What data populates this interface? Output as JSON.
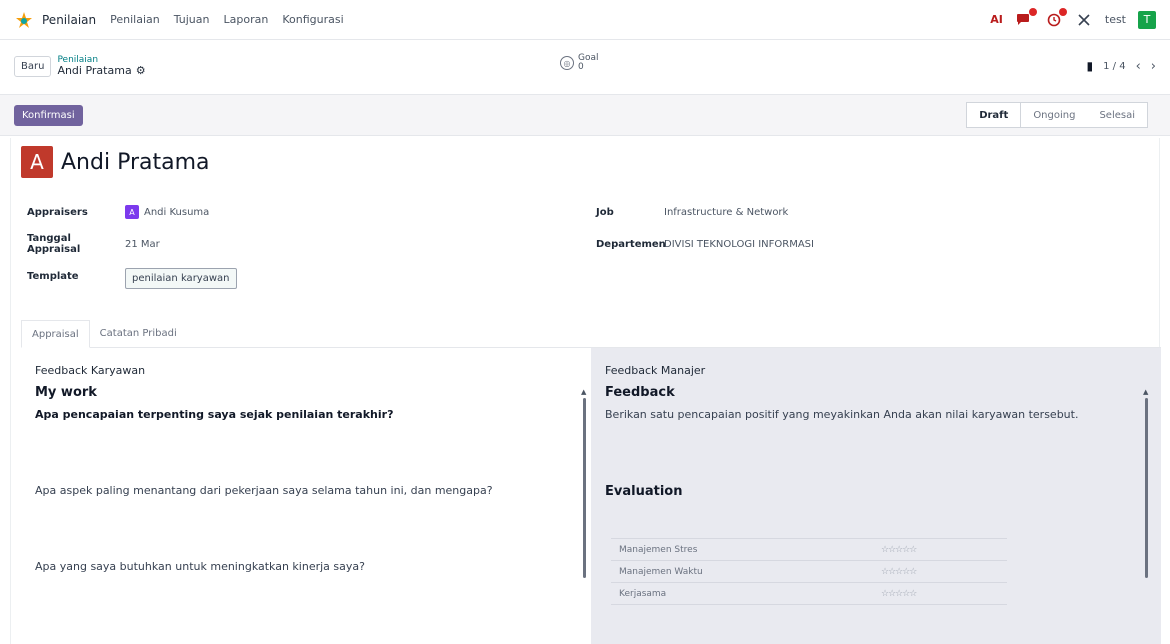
{
  "navbar": {
    "brand": "Penilaian",
    "menu": [
      "Penilaian",
      "Tujuan",
      "Laporan",
      "Konfigurasi"
    ],
    "ai_label": "AI",
    "company": "test",
    "avatar_letter": "T"
  },
  "control": {
    "new_label": "Baru",
    "breadcrumb_parent": "Penilaian",
    "breadcrumb_current": "Andi Pratama",
    "goal_label": "Goal",
    "goal_count": "0",
    "pager": "1 / 4"
  },
  "actions": {
    "confirm_label": "Konfirmasi",
    "stages": [
      "Draft",
      "Ongoing",
      "Selesai"
    ],
    "active_stage": "Draft"
  },
  "record": {
    "avatar_letter": "A",
    "name": "Andi Pratama",
    "fields_left": {
      "appraisers_label": "Appraisers",
      "appraiser_avatar": "A",
      "appraiser_name": "Andi Kusuma",
      "date_label": "Tanggal Appraisal",
      "date_value": "21 Mar",
      "template_label": "Template",
      "template_value": "penilaian karyawan"
    },
    "fields_right": {
      "job_label": "Job",
      "job_value": "Infrastructure & Network",
      "dept_label": "Departemen",
      "dept_value": "DIVISI TEKNOLOGI INFORMASI"
    }
  },
  "tabs": [
    "Appraisal",
    "Catatan Pribadi"
  ],
  "employee_feedback": {
    "header": "Feedback Karyawan",
    "title": "My work",
    "q1": "Apa pencapaian terpenting saya sejak penilaian terakhir?",
    "q2": "Apa aspek paling menantang dari pekerjaan saya selama tahun ini, dan mengapa?",
    "q3": "Apa yang saya butuhkan untuk meningkatkan kinerja saya?"
  },
  "manager_feedback": {
    "header": "Feedback Manajer",
    "title": "Feedback",
    "text": "Berikan satu pencapaian positif yang meyakinkan Anda akan nilai karyawan tersebut.",
    "evaluation_title": "Evaluation",
    "evaluation_rows": [
      {
        "name": "Manajemen Stres",
        "stars": "☆☆☆☆☆"
      },
      {
        "name": "Manajemen Waktu",
        "stars": "☆☆☆☆☆"
      },
      {
        "name": "Kerjasama",
        "stars": "☆☆☆☆☆"
      }
    ]
  }
}
